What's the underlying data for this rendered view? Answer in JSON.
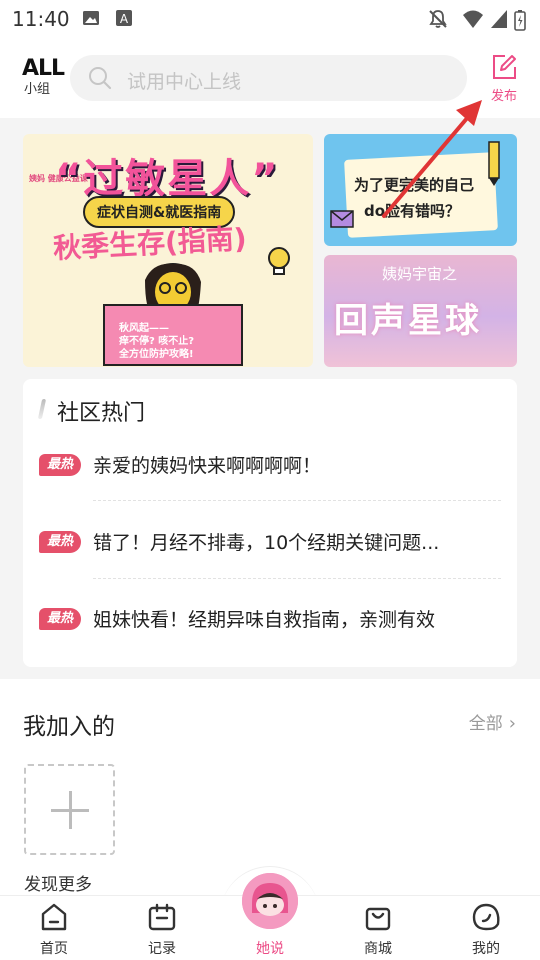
{
  "status_bar": {
    "time": "11:40"
  },
  "header": {
    "brand_title": "ALL",
    "brand_sub": "小组",
    "search_placeholder": "试用中心上线",
    "publish_label": "发布"
  },
  "banners": {
    "main": {
      "title": "“过敏星人”",
      "subtitle": "症状自测&就医指南",
      "subtitle2": "秋季生存(指南)",
      "tag": "姨妈 健康公益课",
      "book_text_1": "秋风起——",
      "book_text_2": "痒不停? 咳不止?",
      "book_text_3": "全方位防护攻略!"
    },
    "top_right": {
      "line1": "为了更完美的自己",
      "line2": "do脸有错吗？"
    },
    "bottom_right": {
      "logo": "姨妈宇宙之",
      "title": "回声星球"
    }
  },
  "community_hot": {
    "title": "社区热门",
    "badge": "最热",
    "items": [
      "亲爱的姨妈快来啊啊啊啊！",
      "错了！月经不排毒，10个经期关键问题...",
      "姐妹快看！经期异味自救指南，亲测有效"
    ]
  },
  "joined": {
    "title": "我加入的",
    "all_label": "全部",
    "discover_label": "发现更多"
  },
  "tabbar": {
    "tabs": [
      {
        "label": "首页"
      },
      {
        "label": "记录"
      },
      {
        "label": "她说"
      },
      {
        "label": "商城"
      },
      {
        "label": "我的"
      }
    ],
    "active": "她说",
    "accent_color": "#ec4c86"
  },
  "colors": {
    "accent": "#ec4c86",
    "hot_badge": "#e5506a",
    "arrow": "#e03535"
  }
}
